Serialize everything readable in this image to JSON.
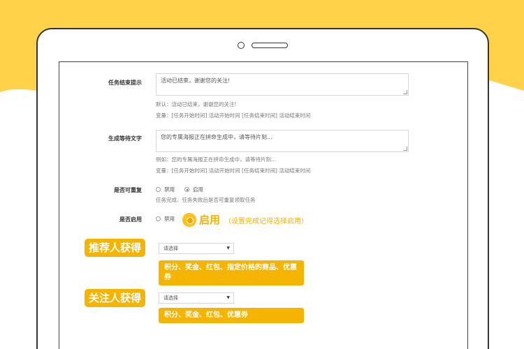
{
  "colors": {
    "accent": "#f5b400",
    "background_yellow": "#ffd24a"
  },
  "form": {
    "task_end_prompt": {
      "label": "任务结束提示",
      "value": "活动已结束，谢谢您的关注!",
      "default_hint": "默认：活动已结束，谢谢您的关注!",
      "variables_hint": "变量：[任务开始时间] 活动开始时间 [任务结束时间] 活动结束时间"
    },
    "generating_text": {
      "label": "生成等待文字",
      "value": "您的专属海报正在拼命生成中，请等待片刻...",
      "example_hint": "例如：您的专属海报正在拼命生成中，请等待片刻...",
      "variables_hint": "变量：[任务开始时间] 活动开始时间 [任务结束时间] 活动结束时间"
    },
    "repeatable": {
      "label": "是否可重复",
      "option_disabled": "禁用",
      "option_enabled": "启用",
      "hint": "任务完成、任务失败后是否可重复领取任务"
    },
    "enabled": {
      "label": "是否启用",
      "option_disabled": "禁用",
      "big_enabled": "启用",
      "big_hint": "（设置完成记得选择启用）"
    },
    "referrer": {
      "tag": "推荐人获得",
      "select_placeholder": "请选择",
      "callout": "积分、奖金、红包、指定价格的商品、优惠券"
    },
    "follower": {
      "tag": "关注人获得",
      "select_placeholder": "请选择",
      "callout": "积分、奖金、红包、优惠券"
    }
  }
}
